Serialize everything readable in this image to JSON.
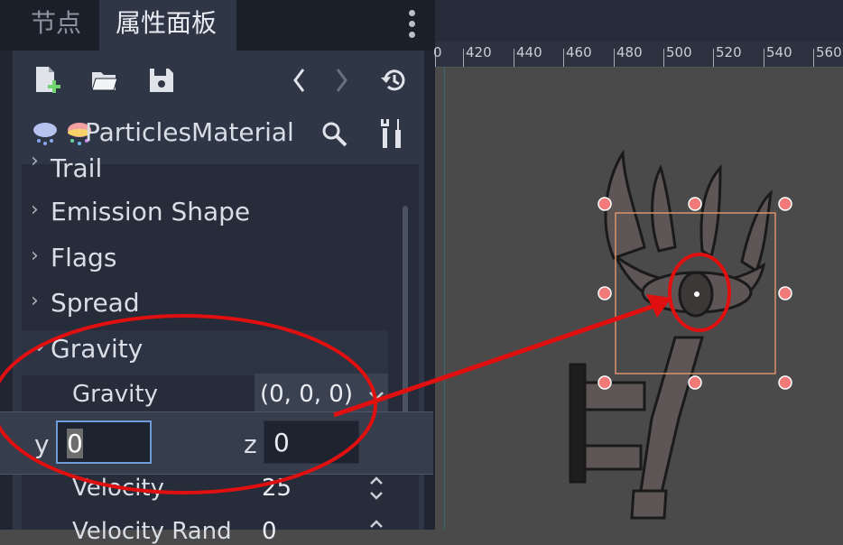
{
  "dock": {
    "tabs": [
      {
        "label": "节点"
      },
      {
        "label": "属性面板"
      }
    ],
    "toolbar": {
      "icons": [
        "new-resource-icon",
        "load-resource-icon",
        "save-resource-icon",
        "history-back-icon",
        "history-forward-icon",
        "object-history-icon"
      ]
    },
    "resource": {
      "name": "ParticlesMaterial",
      "icons": [
        "cloud-icon",
        "rainbow-cloud-icon",
        "search-icon",
        "tools-icon"
      ]
    },
    "sections": [
      {
        "label": "Trail",
        "expanded": false
      },
      {
        "label": "Emission Shape",
        "expanded": false
      },
      {
        "label": "Flags",
        "expanded": false
      },
      {
        "label": "Spread",
        "expanded": false
      },
      {
        "label": "Gravity",
        "expanded": true
      }
    ],
    "properties": {
      "gravity": {
        "label": "Gravity",
        "value": "(0, 0, 0)"
      },
      "velocity": {
        "label": "Velocity",
        "value": "25"
      },
      "velocity_random": {
        "label": "Velocity Rand",
        "value": "0"
      }
    },
    "popup": {
      "y_label": "y",
      "y_value": "0",
      "z_label": "z",
      "z_value": "0"
    }
  },
  "viewport": {
    "ruler_ticks": [
      "0",
      "420",
      "440",
      "460",
      "480",
      "500",
      "520",
      "540",
      "560"
    ],
    "colors": {
      "selection_box": "#d9936a",
      "handle": "#f07a7a",
      "annotation": "#e01010"
    }
  }
}
